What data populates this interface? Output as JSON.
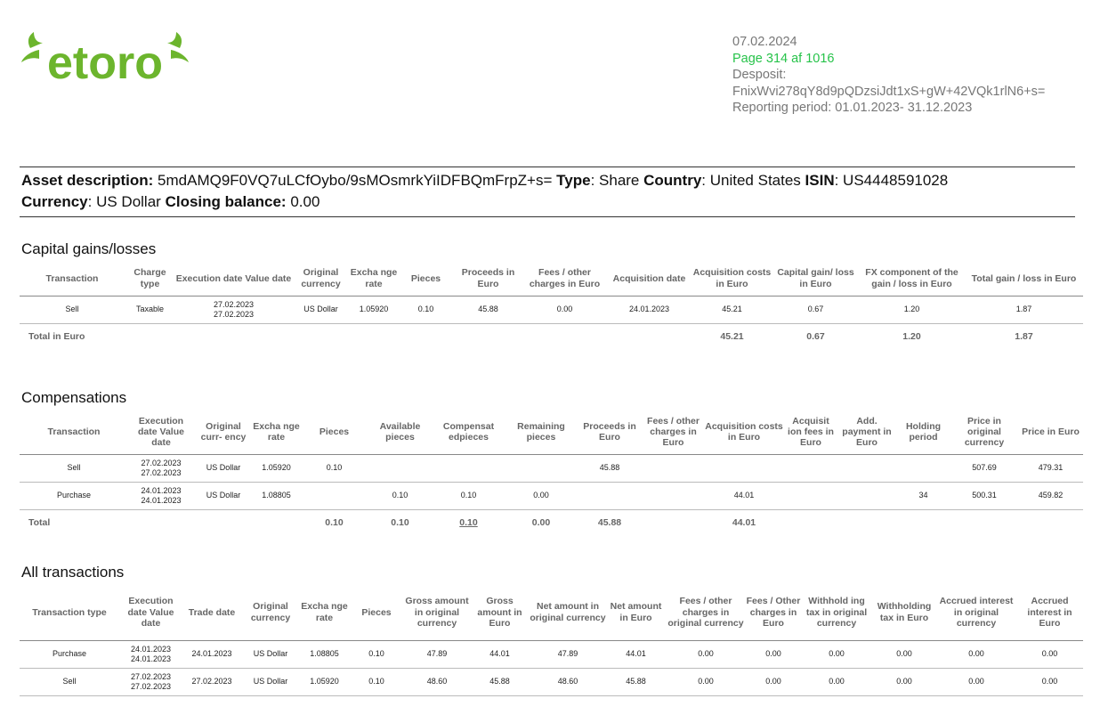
{
  "logo_text": "etoro",
  "header": {
    "date": "07.02.2024",
    "page": "Page 314 af 1016",
    "deposit_label": "Desposit:",
    "deposit_id": "FnixWvi278qY8d9pQDzsiJdt1xS+gW+42VQk1rlN6+s=",
    "reporting_period": "Reporting period: 01.01.2023- 31.12.2023"
  },
  "asset": {
    "desc_label": "Asset description:",
    "desc_value": "5mdAMQ9F0VQ7uLCfOybo/9sMOsmrkYiIDFBQmFrpZ+s=",
    "type_label": "Type",
    "type_value": ": Share",
    "country_label": "Country",
    "country_value": ": United States",
    "isin_label": "ISIN",
    "isin_value": ": US4448591028",
    "currency_label": "Currency",
    "currency_value": ": US Dollar",
    "closing_label": "Closing balance:",
    "closing_value": "0.00"
  },
  "capital": {
    "title": "Capital gains/losses",
    "headers": [
      "Transaction",
      "Charge type",
      "Execution date Value date",
      "Original currency",
      "Excha nge rate",
      "Pieces",
      "Proceeds in Euro",
      "Fees / other charges in Euro",
      "Acquisition date",
      "Acquisition costs in Euro",
      "Capital gain/ loss in Euro",
      "FX component of the gain / loss in Euro",
      "Total gain / loss in Euro"
    ],
    "rows": [
      [
        "Sell",
        "Taxable",
        "27.02.2023\n27.02.2023",
        "US Dollar",
        "1.05920",
        "0.10",
        "45.88",
        "0.00",
        "24.01.2023",
        "45.21",
        "0.67",
        "1.20",
        "1.87"
      ]
    ],
    "total": [
      "Total in Euro",
      "",
      "",
      "",
      "",
      "",
      "",
      "",
      "",
      "45.21",
      "0.67",
      "1.20",
      "1.87"
    ]
  },
  "comp": {
    "title": "Compensations",
    "headers": [
      "Transaction",
      "Execution date Value date",
      "Original curr- ency",
      "Excha nge rate",
      "Pieces",
      "Available pieces",
      "Compensat edpieces",
      "Remaining pieces",
      "Proceeds in Euro",
      "Fees / other charges in Euro",
      "Acquisition costs in Euro",
      "Acquisit ion fees in Euro",
      "Add. payment in Euro",
      "Holding period",
      "Price in original currency",
      "Price in Euro"
    ],
    "rows": [
      [
        "Sell",
        "27.02.2023\n27.02.2023",
        "US Dollar",
        "1.05920",
        "0.10",
        "",
        "",
        "",
        "45.88",
        "",
        "",
        "",
        "",
        "",
        "507.69",
        "479.31"
      ],
      [
        "Purchase",
        "24.01.2023\n24.01.2023",
        "US Dollar",
        "1.08805",
        "",
        "0.10",
        "0.10",
        "0.00",
        "",
        "",
        "44.01",
        "",
        "",
        "34",
        "500.31",
        "459.82"
      ]
    ],
    "total": [
      "Total",
      "",
      "",
      "",
      "0.10",
      "0.10",
      "0.10",
      "0.00",
      "45.88",
      "",
      "44.01",
      "",
      "",
      "",
      "",
      ""
    ]
  },
  "all": {
    "title": "All transactions",
    "headers": [
      "Transaction type",
      "Execution date Value date",
      "Trade date",
      "Original currency",
      "Excha nge rate",
      "Pieces",
      "Gross amount in original currency",
      "Gross amount in Euro",
      "Net amount in original currency",
      "Net amount in Euro",
      "Fees / other charges in original currency",
      "Fees / Other charges in Euro",
      "Withhold ing tax in original currency",
      "Withholding tax in Euro",
      "Accrued interest in original currency",
      "Accrued interest in Euro"
    ],
    "rows": [
      [
        "Purchase",
        "24.01.2023\n24.01.2023",
        "24.01.2023",
        "US Dollar",
        "1.08805",
        "0.10",
        "47.89",
        "44.01",
        "47.89",
        "44.01",
        "0.00",
        "0.00",
        "0.00",
        "0.00",
        "0.00",
        "0.00"
      ],
      [
        "Sell",
        "27.02.2023\n27.02.2023",
        "27.02.2023",
        "US Dollar",
        "1.05920",
        "0.10",
        "48.60",
        "45.88",
        "48.60",
        "45.88",
        "0.00",
        "0.00",
        "0.00",
        "0.00",
        "0.00",
        "0.00"
      ]
    ]
  },
  "colors": {
    "brand": "#6cb52d",
    "page_number": "#27c34a"
  }
}
